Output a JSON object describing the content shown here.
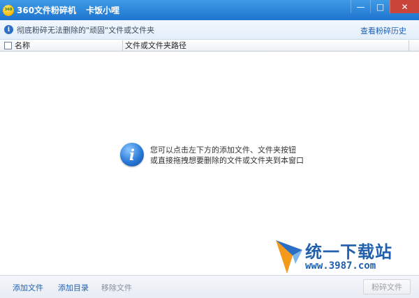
{
  "window": {
    "app_logo": "360",
    "app_title": "360文件粉碎机",
    "user_name": "卡饭小哩",
    "controls": {
      "minimize": "—",
      "maximize": "□",
      "close": "✕"
    }
  },
  "infobar": {
    "icon": "info-icon",
    "message": "彻底粉碎无法删除的\"顽固\"文件或文件夹",
    "history_link": "查看粉碎历史"
  },
  "table": {
    "columns": [
      "名称",
      "文件或文件夹路径"
    ],
    "rows": []
  },
  "empty_state": {
    "icon": "info-icon",
    "line1": "您可以点击左下方的添加文件、文件夹按钮",
    "line2": "或直接拖拽想要删除的文件或文件夹到本窗口"
  },
  "watermark": {
    "title": "统一下载站",
    "url": "www.3987.com"
  },
  "footer": {
    "add_file": "添加文件",
    "add_folder": "添加目录",
    "remove_file": "移除文件",
    "shred_button": "粉碎文件"
  },
  "colors": {
    "titlebar": "#2a84dc",
    "link": "#1e5fb3",
    "close_button": "#c9453a",
    "watermark_blue": "#1f5fae",
    "watermark_orange": "#f39a1b"
  }
}
